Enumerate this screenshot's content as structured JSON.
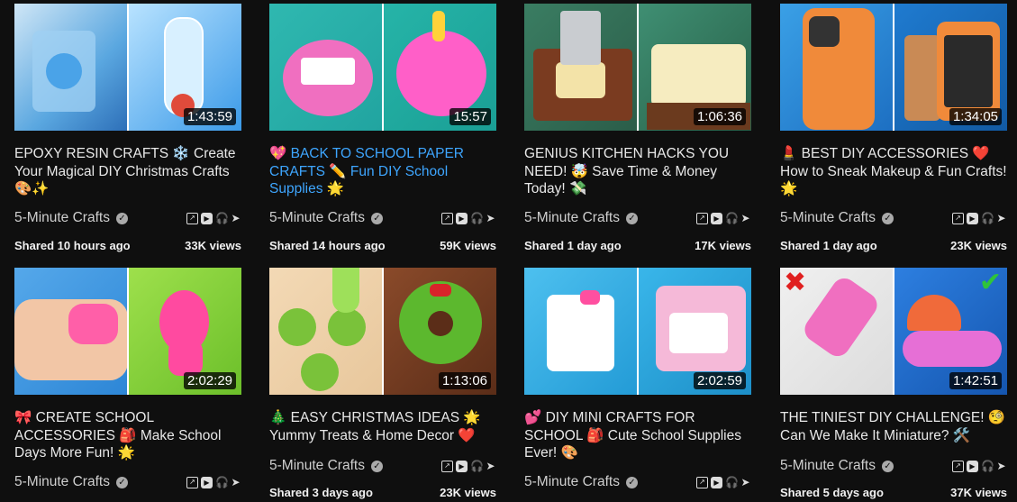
{
  "channel_name": "5-Minute Crafts",
  "videos": [
    {
      "title": "EPOXY RESIN CRAFTS ❄️ Create Your Magical DIY Christmas Crafts 🎨✨",
      "duration": "1:43:59",
      "shared": "Shared 10 hours ago",
      "views": "33K views",
      "title_color": "white"
    },
    {
      "title": "💖 BACK TO SCHOOL PAPER CRAFTS ✏️ Fun DIY School Supplies 🌟",
      "duration": "15:57",
      "shared": "Shared 14 hours ago",
      "views": "59K views",
      "title_color": "blue"
    },
    {
      "title": "GENIUS KITCHEN HACKS YOU NEED! 🤯 Save Time & Money Today! 💸",
      "duration": "1:06:36",
      "shared": "Shared 1 day ago",
      "views": "17K views",
      "title_color": "white"
    },
    {
      "title": "💄 BEST DIY ACCESSORIES ❤️ How to Sneak Makeup & Fun Crafts! 🌟",
      "duration": "1:34:05",
      "shared": "Shared 1 day ago",
      "views": "23K views",
      "title_color": "white"
    },
    {
      "title": "🎀 CREATE SCHOOL ACCESSORIES 🎒 Make School Days More Fun! 🌟",
      "duration": "2:02:29",
      "shared": "",
      "views": "",
      "title_color": "white"
    },
    {
      "title": "🎄 EASY CHRISTMAS IDEAS 🌟 Yummy Treats & Home Decor ❤️",
      "duration": "1:13:06",
      "shared": "Shared 3 days ago",
      "views": "23K views",
      "title_color": "white"
    },
    {
      "title": "💕 DIY MINI CRAFTS FOR SCHOOL 🎒 Cute School Supplies Ever! 🎨",
      "duration": "2:02:59",
      "shared": "",
      "views": "",
      "title_color": "white"
    },
    {
      "title": "THE TINIEST DIY CHALLENGE! 🧐 Can We Make It Miniature? 🛠️",
      "duration": "1:42:51",
      "shared": "Shared 5 days ago",
      "views": "37K views",
      "title_color": "white"
    }
  ],
  "icons": [
    "external-link-icon",
    "youtube-icon",
    "headphones-icon",
    "send-icon"
  ],
  "colors": {
    "background": "#0f0f0f",
    "title_blue": "#3ea6ff",
    "text": "#e8e8e8"
  }
}
